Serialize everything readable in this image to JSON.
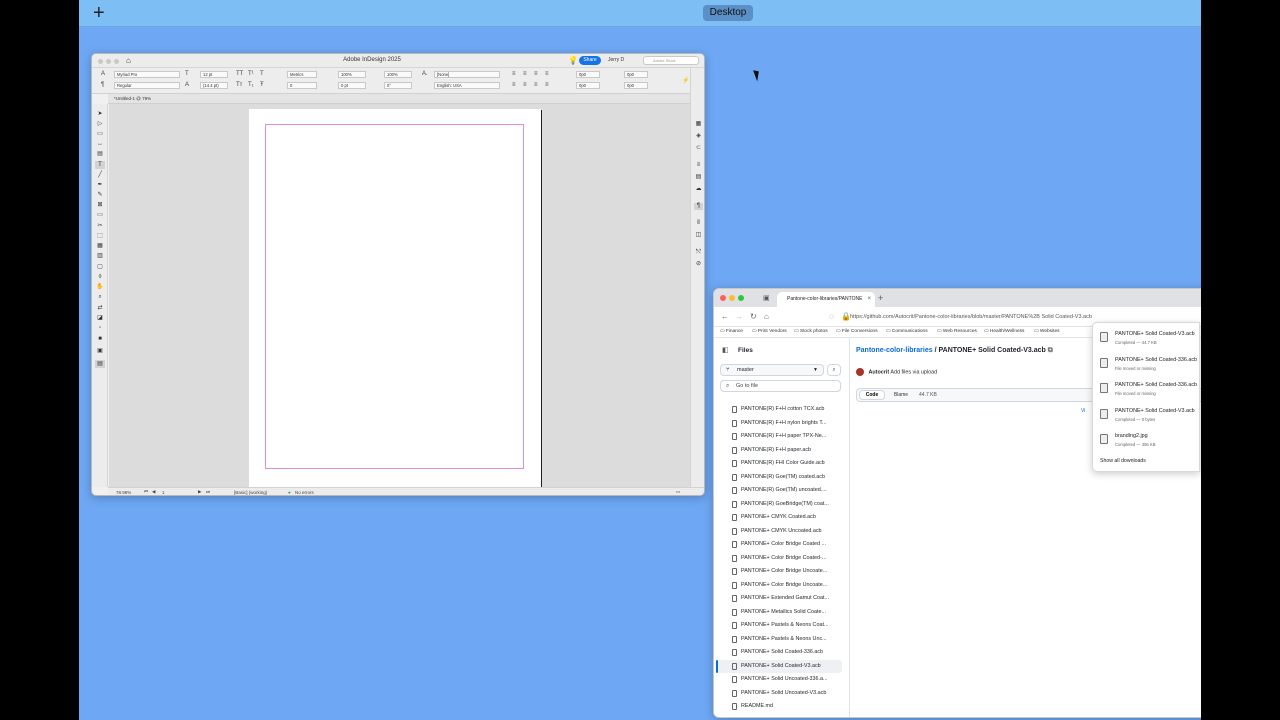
{
  "desktop": {
    "label": "Desktop",
    "add_symbol": "+"
  },
  "indesign": {
    "app_title": "Adobe InDesign 2025",
    "share_label": "Share",
    "user_label": "Jerry D",
    "stock_placeholder": "Adobe Stock",
    "doc_tab": "*Untitled-1 @ 79%",
    "font_family": "Myriad Pro",
    "font_style": "Regular",
    "font_size": "12 pt",
    "leading": "(14.4 pt)",
    "kerning": "Metrics",
    "tracking": "0",
    "vscale": "100%",
    "hscale": "100%",
    "baseline": "0 pt",
    "skew": "0°",
    "char_style": "[None]",
    "language": "English: USA",
    "indent_left": "0p0",
    "indent_right": "0p0",
    "space_before": "0p0",
    "space_after": "0p0",
    "zoom": "78.98%",
    "page_number": "1",
    "preflight_profile": "[Basic] (working)",
    "errors": "No errors"
  },
  "browser": {
    "tab_title": "Pantone-color-libraries/PANTONE",
    "url": "https://github.com/Autocrit/Pantone-color-libraries/blob/master/PANTONE%2B Solid Coated-V3.acb",
    "bookmarks": [
      "Finance",
      "Print Vendors",
      "Stock photos",
      "File Conversions",
      "Communications",
      "Web Resources",
      "Health/Wellness",
      "Websites"
    ]
  },
  "github": {
    "files_title": "Files",
    "branch": "master",
    "goto_placeholder": "Go to file",
    "repo_name": "Pantone-color-libraries",
    "path_separator": "/",
    "file_name": "PANTONE+ Solid Coated-V3.acb",
    "commit_author": "Autocrit",
    "commit_message": "Add files via upload",
    "code_tab": "Code",
    "blame_tab": "Blame",
    "file_size": "44.7 KB",
    "view_link": "Vi",
    "files": [
      "PANTONE(R) F+H cotton TCX.acb",
      "PANTONE(R) F+H nylon brights T...",
      "PANTONE(R) F+H paper TPX-Ne...",
      "PANTONE(R) F+H paper.acb",
      "PANTONE(R) FHI Color Guide.acb",
      "PANTONE(R) Goe(TM) coated.acb",
      "PANTONE(R) Goe(TM) uncoated....",
      "PANTONE(R) GoeBridge(TM) coat...",
      "PANTONE+ CMYK Coated.acb",
      "PANTONE+ CMYK Uncoated.acb",
      "PANTONE+ Color Bridge Coated ...",
      "PANTONE+ Color Bridge Coated-...",
      "PANTONE+ Color Bridge Uncoate...",
      "PANTONE+ Color Bridge Uncoate...",
      "PANTONE+ Extended Gamut Coat...",
      "PANTONE+ Metallics Solid Coate...",
      "PANTONE+ Pastels & Neons Coat...",
      "PANTONE+ Pastels & Neons Unc...",
      "PANTONE+ Solid Coated-336.acb",
      "PANTONE+ Solid Coated-V3.acb",
      "PANTONE+ Solid Uncoated-336.a...",
      "PANTONE+ Solid Uncoated-V3.acb",
      "README.md"
    ],
    "selected_index": 19
  },
  "downloads": {
    "items": [
      {
        "name": "PANTONE+ Solid Coated-V3.acb",
        "status": "Completed — 44.7 KB"
      },
      {
        "name": "PANTONE+ Solid Coated-336.acb",
        "status": "File moved or missing"
      },
      {
        "name": "PANTONE+ Solid Coated-336.acb",
        "status": "File moved or missing"
      },
      {
        "name": "PANTONE+ Solid Coated-V3.acb",
        "status": "Completed — 0 bytes"
      },
      {
        "name": "branding2.jpg",
        "status": "Completed — 356 KB"
      }
    ],
    "show_all": "Show all downloads"
  }
}
